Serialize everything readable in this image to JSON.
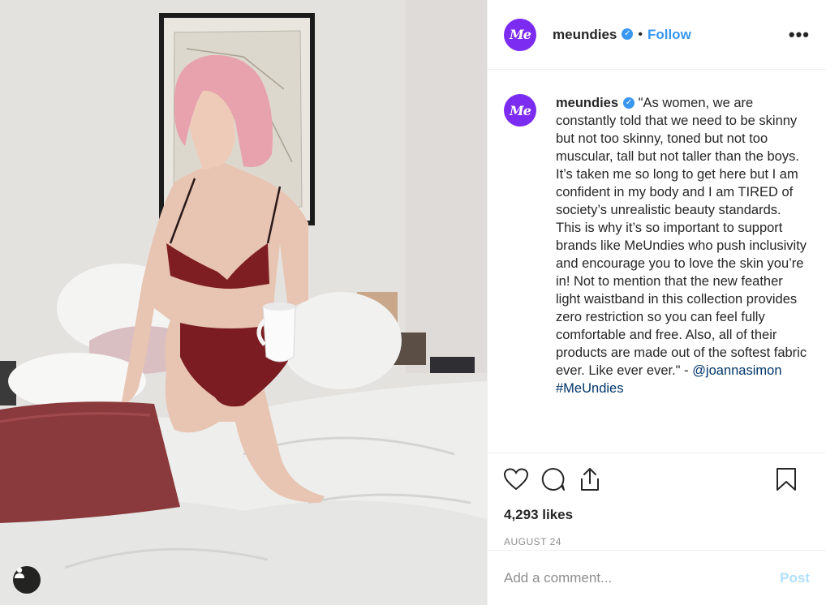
{
  "post": {
    "image_icon": "user-tag-icon"
  },
  "account": {
    "avatar_text": "Me",
    "username": "meundies",
    "verified_icon": "verified-badge-icon",
    "separator": "•",
    "follow_label": "Follow",
    "more_icon": "more-options-icon"
  },
  "caption": {
    "username": "meundies",
    "text": "\"As women, we are constantly told that we need to be skinny but not too skinny, toned but not too muscular, tall but not taller than the boys. It’s taken me so long to get here but I am confident in my body and I am TIRED of society’s unrealistic beauty standards. This is why it’s so important to support brands like MeUndies who push inclusivity and encourage you to love the skin you’re in! Not to mention that the new feather light waistband in this collection provides zero restriction so you can feel fully comfortable and free. Also, all of their products are made out of the softest fabric ever. Like ever ever.\" - ",
    "mention": "@joannasimon",
    "hashtag": "#MeUndies"
  },
  "actions": {
    "like_icon": "heart-icon",
    "comment_icon": "comment-icon",
    "share_icon": "share-icon",
    "save_icon": "bookmark-icon"
  },
  "likes": "4,293 likes",
  "date": "AUGUST 24",
  "comment_box": {
    "placeholder": "Add a comment...",
    "post_label": "Post"
  },
  "colors": {
    "brand_purple": "#7b2cf0",
    "link_blue": "#3897f0",
    "post_disabled": "#b2dffc"
  }
}
